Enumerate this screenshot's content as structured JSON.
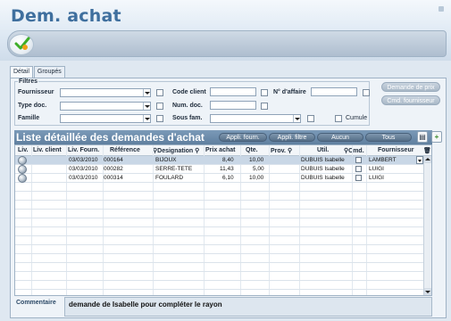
{
  "app": {
    "title": "Dem. achat"
  },
  "tabs": [
    {
      "label": "Détail",
      "active": true
    },
    {
      "label": "Groupés",
      "active": false
    }
  ],
  "filters": {
    "legend": "Filtres",
    "fournisseur_label": "Fournisseur",
    "code_client_label": "Code client",
    "affaire_label": "N° d'affaire",
    "type_doc_label": "Type doc.",
    "num_doc_label": "Num. doc.",
    "famille_label": "Famille",
    "sous_fam_label": "Sous fam.",
    "cumule_label": "Cumule"
  },
  "side_buttons": {
    "demande": "Demande de prix",
    "cmd": "Cmd. fournisseur"
  },
  "list": {
    "title": "Liste détaillée des demandes d'achat",
    "buttons": [
      "Appli. fourn.",
      "Appli. filtre",
      "Aucun",
      "Tous"
    ],
    "columns": [
      "Liv.",
      "Liv. client",
      "Liv. Fourn.",
      "Référence",
      "Designation",
      "Prix achat",
      "Qte.",
      "Prov.",
      "Util.",
      "Cmd.",
      "Fournisseur"
    ],
    "rows": [
      {
        "liv_fourn": "03/03/2010",
        "reference": "000164",
        "designation": "BIJOUX",
        "prix": "8,40",
        "qte": "10,00",
        "util": "DUBUIS Isabelle",
        "fournisseur": "LAMBERT",
        "selected": true
      },
      {
        "liv_fourn": "03/03/2010",
        "reference": "000282",
        "designation": "SERRE-TETE",
        "prix": "11,43",
        "qte": "5,00",
        "util": "DUBUIS Isabelle",
        "fournisseur": "LUIGI",
        "selected": false
      },
      {
        "liv_fourn": "03/03/2010",
        "reference": "000314",
        "designation": "FOULARD",
        "prix": "6,10",
        "qte": "10,00",
        "util": "DUBUIS Isabelle",
        "fournisseur": "LUIGI",
        "selected": false
      }
    ]
  },
  "comment": {
    "label": "Commentaire",
    "text": "demande de Isabelle pour compléter le rayon"
  }
}
